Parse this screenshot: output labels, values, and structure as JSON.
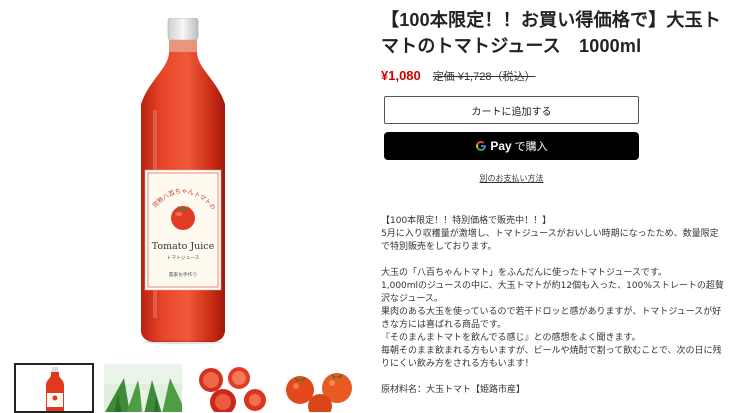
{
  "product": {
    "title": "【100本限定！！お買い得価格で】大玉トマトのトマトジュース　1000ml",
    "price": "¥1,080",
    "regular_price": "定価 ¥1,728（税込）",
    "bottle_label": {
      "arc_text": "完熟八百ちゃんトマトの",
      "brand": "Tomato Juice",
      "sub": "トマトジュース",
      "bottom": "農家お手作り"
    }
  },
  "actions": {
    "add_to_cart": "カートに追加する",
    "gpay_brand": "Pay",
    "gpay_action": "で購入",
    "other_payments": "別のお支払い方法"
  },
  "description": {
    "block1": [
      "【100本限定！！特別価格で販売中！！】",
      "5月に入り収穫量が激増し、トマトジュースがおいしい時期になったため、数量限定で特別販売をしております。"
    ],
    "block2": [
      "大玉の「八百ちゃんトマト」をふんだんに使ったトマトジュースです。",
      "1,000mlのジュースの中に、大玉トマトが約12個も入った、100%ストレートの超贅沢なジュース。",
      "果肉のある大玉を使っているので若干ドロッと感がありますが、トマトジュースが好きな方には喜ばれる商品です。",
      "『そのまんまトマトを飲んでる感じ』との感想をよく聞きます。",
      "毎朝そのまま飲まれる方もいますが、ビールや焼酎で割って飲むことで、次の日に残りにくい飲み方をされる方もいます！"
    ],
    "block3": [
      "原材料名：大玉トマト【姫路市産】"
    ]
  },
  "colors": {
    "price_red": "#d10000",
    "juice_red": "#e0391f"
  }
}
